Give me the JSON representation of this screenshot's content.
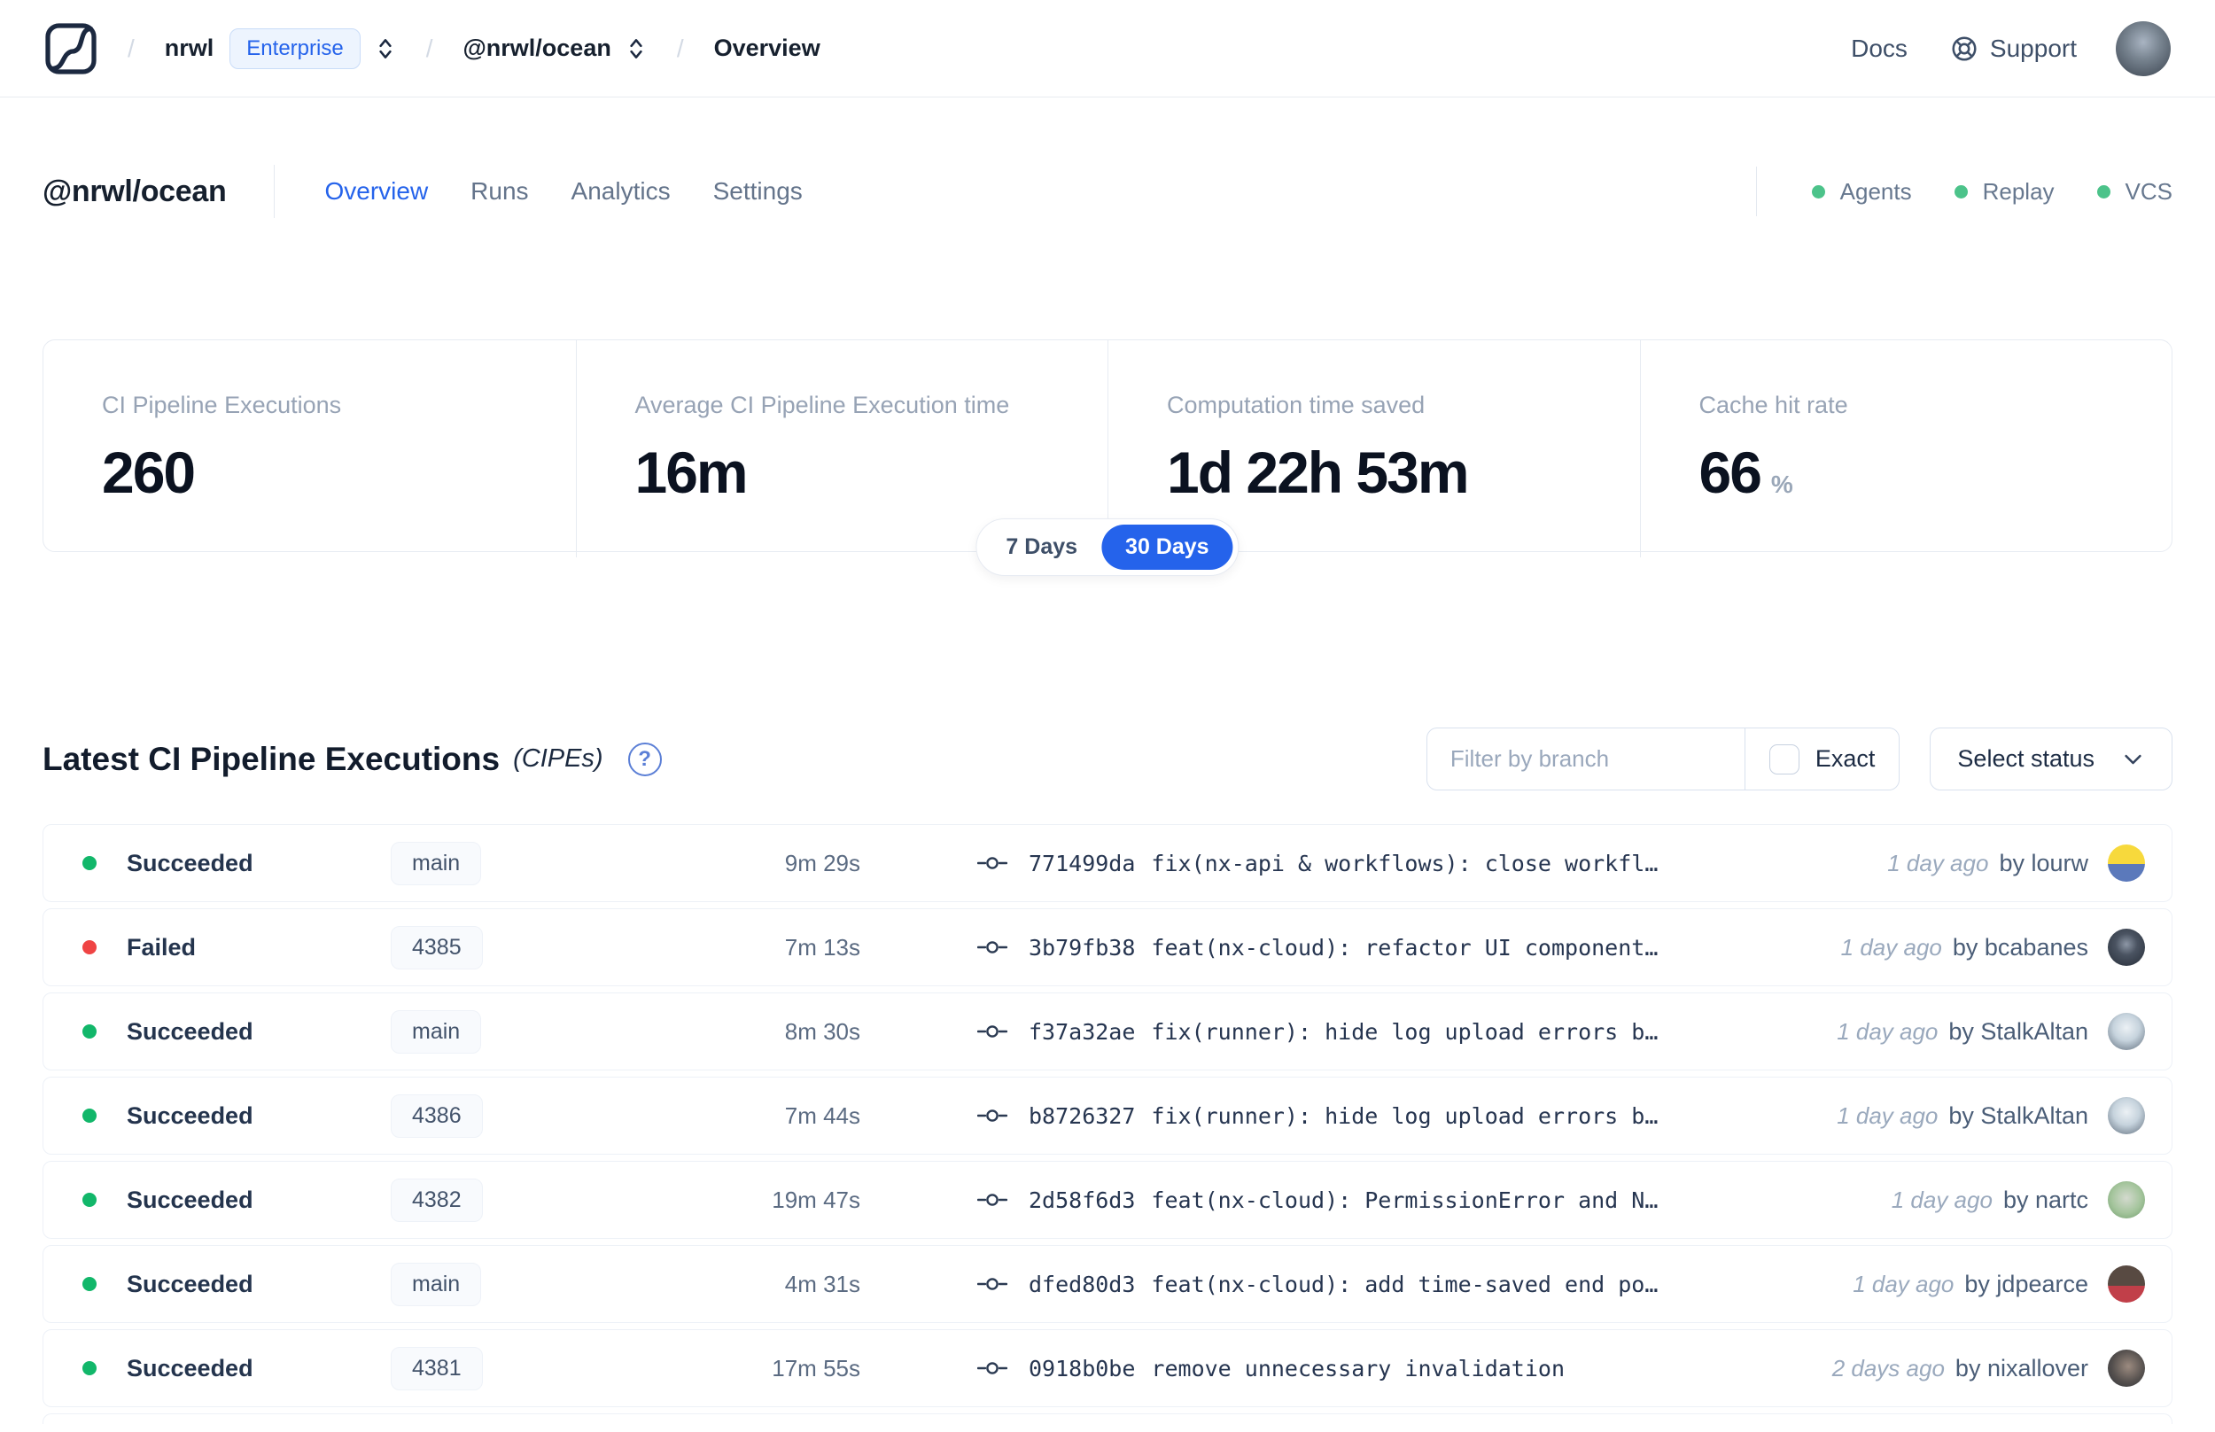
{
  "navbar": {
    "breadcrumb": {
      "separator": "/",
      "org": "nrwl",
      "org_badge": "Enterprise",
      "workspace": "@nrwl/ocean",
      "page": "Overview"
    },
    "docs_label": "Docs",
    "support_label": "Support"
  },
  "workspace_header": {
    "title": "@nrwl/ocean",
    "tabs": [
      {
        "label": "Overview",
        "active": true
      },
      {
        "label": "Runs",
        "active": false
      },
      {
        "label": "Analytics",
        "active": false
      },
      {
        "label": "Settings",
        "active": false
      }
    ],
    "features": [
      {
        "label": "Agents",
        "status": "on"
      },
      {
        "label": "Replay",
        "status": "on"
      },
      {
        "label": "VCS",
        "status": "on"
      }
    ]
  },
  "stats": {
    "cards": [
      {
        "label": "CI Pipeline Executions",
        "value": "260"
      },
      {
        "label": "Average CI Pipeline Execution time",
        "value": "16m"
      },
      {
        "label": "Computation time saved",
        "value": "1d 22h 53m"
      },
      {
        "label": "Cache hit rate",
        "value": "66",
        "suffix": "%"
      }
    ],
    "range_toggle": {
      "options": [
        "7 Days",
        "30 Days"
      ],
      "selected": "30 Days"
    }
  },
  "cipe_section": {
    "title": "Latest CI Pipeline Executions",
    "title_suffix": "(CIPEs)",
    "help_icon": "?",
    "filter": {
      "branch_placeholder": "Filter by branch",
      "exact_label": "Exact",
      "exact_checked": false,
      "status_label": "Select status"
    },
    "rows": [
      {
        "status": "Succeeded",
        "branch": "main",
        "duration": "9m 29s",
        "commit_hash": "771499da",
        "commit_message": "fix(nx-api & workflows): close workfl…",
        "time_ago": "1 day ago",
        "author": "lourw",
        "author_label": "by lourw",
        "avatar": "minion"
      },
      {
        "status": "Failed",
        "branch": "4385",
        "duration": "7m 13s",
        "commit_hash": "3b79fb38",
        "commit_message": "feat(nx-cloud): refactor UI component…",
        "time_ago": "1 day ago",
        "author": "bcabanes",
        "author_label": "by bcabanes",
        "avatar": "hooded-person"
      },
      {
        "status": "Succeeded",
        "branch": "main",
        "duration": "8m 30s",
        "commit_hash": "f37a32ae",
        "commit_message": "fix(runner): hide log upload errors b…",
        "time_ago": "1 day ago",
        "author": "StalkAltan",
        "author_label": "by StalkAltan",
        "avatar": "person-sunglasses"
      },
      {
        "status": "Succeeded",
        "branch": "4386",
        "duration": "7m 44s",
        "commit_hash": "b8726327",
        "commit_message": "fix(runner): hide log upload errors b…",
        "time_ago": "1 day ago",
        "author": "StalkAltan",
        "author_label": "by StalkAltan",
        "avatar": "person-sunglasses"
      },
      {
        "status": "Succeeded",
        "branch": "4382",
        "duration": "19m 47s",
        "commit_hash": "2d58f6d3",
        "commit_message": "feat(nx-cloud): PermissionError and N…",
        "time_ago": "1 day ago",
        "author": "nartc",
        "author_label": "by nartc",
        "avatar": "person-outdoor"
      },
      {
        "status": "Succeeded",
        "branch": "main",
        "duration": "4m 31s",
        "commit_hash": "dfed80d3",
        "commit_message": "feat(nx-cloud): add time-saved end po…",
        "time_ago": "1 day ago",
        "author": "jdpearce",
        "author_label": "by jdpearce",
        "avatar": "person-red-shirt"
      },
      {
        "status": "Succeeded",
        "branch": "4381",
        "duration": "17m 55s",
        "commit_hash": "0918b0be",
        "commit_message": "remove unnecessary invalidation",
        "time_ago": "2 days ago",
        "author": "nixallover",
        "author_label": "by nixallover",
        "avatar": "person-dark"
      }
    ]
  },
  "colors": {
    "accent_blue": "#2563eb",
    "success_green": "#12b76a",
    "failed_red": "#ef4444",
    "feature_dot_green": "#4cc38a"
  }
}
